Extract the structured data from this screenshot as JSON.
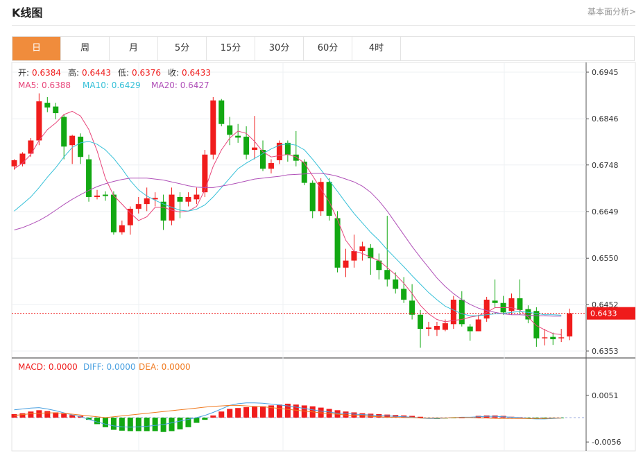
{
  "page": {
    "title": "K线图",
    "analysis_link": "基本面分析>"
  },
  "tabs": [
    "日",
    "周",
    "月",
    "5分",
    "15分",
    "30分",
    "60分",
    "4时"
  ],
  "active_tab": 0,
  "ohlc_legend": {
    "open_label": "开:",
    "open": "0.6384",
    "high_label": "高:",
    "high": "0.6443",
    "low_label": "低:",
    "low": "0.6376",
    "close_label": "收:",
    "close": "0.6433"
  },
  "ma_legend": {
    "ma5": "MA5: 0.6388",
    "ma10": "MA10: 0.6429",
    "ma20": "MA20: 0.6427"
  },
  "macd_legend": {
    "macd": "MACD: 0.0000",
    "diff": "DIFF: 0.0000",
    "dea": "DEA: 0.0000"
  },
  "colors": {
    "up": "#f01c1c",
    "down": "#12a812",
    "ma5": "#e8457a",
    "ma10": "#35c0d8",
    "ma20": "#b050b8",
    "diff": "#4aa0e0",
    "dea": "#f07a20",
    "current": "#ef1b1b",
    "accent_tab": "#f08c3c"
  },
  "chart_data": [
    {
      "type": "candlestick",
      "title": "",
      "ylim": [
        0.6325,
        0.6975
      ],
      "y_ticks": [
        "0.6945",
        "0.6846",
        "0.6748",
        "0.6649",
        "0.6550",
        "0.6452",
        "0.6353"
      ],
      "current_price": "0.6433",
      "candles": [
        [
          0.6745,
          0.6758,
          0.6738,
          0.676
        ],
        [
          0.675,
          0.6772,
          0.6745,
          0.6775
        ],
        [
          0.6772,
          0.68,
          0.6765,
          0.6805
        ],
        [
          0.68,
          0.6883,
          0.679,
          0.69
        ],
        [
          0.688,
          0.687,
          0.686,
          0.6892
        ],
        [
          0.6872,
          0.6858,
          0.6845,
          0.688
        ],
        [
          0.685,
          0.6787,
          0.676,
          0.6856
        ],
        [
          0.679,
          0.681,
          0.675,
          0.6812
        ],
        [
          0.6808,
          0.6765,
          0.675,
          0.6815
        ],
        [
          0.676,
          0.668,
          0.667,
          0.677
        ],
        [
          0.668,
          0.6683,
          0.6675,
          0.6695
        ],
        [
          0.6685,
          0.6682,
          0.6672,
          0.6692
        ],
        [
          0.6685,
          0.6605,
          0.66,
          0.6692
        ],
        [
          0.6605,
          0.662,
          0.66,
          0.663
        ],
        [
          0.662,
          0.6655,
          0.66,
          0.666
        ],
        [
          0.6655,
          0.6665,
          0.6645,
          0.668
        ],
        [
          0.6665,
          0.6677,
          0.665,
          0.67
        ],
        [
          0.6675,
          0.6678,
          0.666,
          0.669
        ],
        [
          0.667,
          0.663,
          0.661,
          0.6685
        ],
        [
          0.663,
          0.6685,
          0.662,
          0.67
        ],
        [
          0.668,
          0.667,
          0.6635,
          0.669
        ],
        [
          0.667,
          0.668,
          0.666,
          0.669
        ],
        [
          0.6675,
          0.6685,
          0.6665,
          0.67
        ],
        [
          0.669,
          0.677,
          0.668,
          0.678
        ],
        [
          0.677,
          0.6885,
          0.676,
          0.6892
        ],
        [
          0.6885,
          0.6835,
          0.683,
          0.6888
        ],
        [
          0.6832,
          0.6812,
          0.679,
          0.685
        ],
        [
          0.681,
          0.6806,
          0.6795,
          0.6835
        ],
        [
          0.6808,
          0.677,
          0.676,
          0.683
        ],
        [
          0.678,
          0.6785,
          0.676,
          0.6852
        ],
        [
          0.678,
          0.674,
          0.6735,
          0.68
        ],
        [
          0.674,
          0.6752,
          0.673,
          0.676
        ],
        [
          0.6758,
          0.6795,
          0.675,
          0.68
        ],
        [
          0.6795,
          0.677,
          0.6755,
          0.68
        ],
        [
          0.677,
          0.6757,
          0.6745,
          0.682
        ],
        [
          0.6755,
          0.671,
          0.6705,
          0.676
        ],
        [
          0.671,
          0.665,
          0.6635,
          0.6715
        ],
        [
          0.665,
          0.6712,
          0.664,
          0.672
        ],
        [
          0.6712,
          0.664,
          0.663,
          0.672
        ],
        [
          0.6635,
          0.653,
          0.652,
          0.665
        ],
        [
          0.653,
          0.6545,
          0.651,
          0.657
        ],
        [
          0.6545,
          0.6565,
          0.653,
          0.66
        ],
        [
          0.6565,
          0.6575,
          0.6545,
          0.6585
        ],
        [
          0.6572,
          0.655,
          0.6515,
          0.658
        ],
        [
          0.6545,
          0.6525,
          0.6505,
          0.656
        ],
        [
          0.6525,
          0.6505,
          0.649,
          0.664
        ],
        [
          0.6505,
          0.6485,
          0.6475,
          0.652
        ],
        [
          0.6485,
          0.6462,
          0.6455,
          0.651
        ],
        [
          0.646,
          0.643,
          0.642,
          0.6495
        ],
        [
          0.643,
          0.64,
          0.636,
          0.644
        ],
        [
          0.64,
          0.6403,
          0.6385,
          0.6415
        ],
        [
          0.6398,
          0.6406,
          0.6385,
          0.6415
        ],
        [
          0.6398,
          0.6412,
          0.6395,
          0.642
        ],
        [
          0.641,
          0.6462,
          0.64,
          0.647
        ],
        [
          0.6462,
          0.641,
          0.6405,
          0.648
        ],
        [
          0.6405,
          0.6395,
          0.6375,
          0.641
        ],
        [
          0.6395,
          0.642,
          0.6395,
          0.643
        ],
        [
          0.6422,
          0.6462,
          0.6415,
          0.6468
        ],
        [
          0.646,
          0.6455,
          0.6445,
          0.6505
        ],
        [
          0.6455,
          0.6435,
          0.643,
          0.647
        ],
        [
          0.6438,
          0.6465,
          0.643,
          0.6475
        ],
        [
          0.6465,
          0.644,
          0.643,
          0.6505
        ],
        [
          0.6442,
          0.642,
          0.6412,
          0.645
        ],
        [
          0.6438,
          0.638,
          0.6362,
          0.6446
        ],
        [
          0.638,
          0.6382,
          0.6365,
          0.64
        ],
        [
          0.6383,
          0.6378,
          0.6366,
          0.6392
        ],
        [
          0.638,
          0.6382,
          0.6372,
          0.64
        ],
        [
          0.6384,
          0.6433,
          0.6376,
          0.6443
        ]
      ],
      "ma5": [
        0.674,
        0.6752,
        0.677,
        0.68,
        0.6823,
        0.6837,
        0.6855,
        0.6862,
        0.6852,
        0.6823,
        0.6778,
        0.672,
        0.6683,
        0.6665,
        0.6646,
        0.663,
        0.6638,
        0.6658,
        0.6658,
        0.6652,
        0.6648,
        0.665,
        0.666,
        0.6695,
        0.6745,
        0.678,
        0.6805,
        0.682,
        0.6815,
        0.6798,
        0.6776,
        0.6765,
        0.6768,
        0.677,
        0.6765,
        0.6752,
        0.6725,
        0.6697,
        0.667,
        0.6632,
        0.6588,
        0.6565,
        0.656,
        0.6552,
        0.6545,
        0.653,
        0.6515,
        0.6497,
        0.6475,
        0.645,
        0.6432,
        0.642,
        0.6415,
        0.6418,
        0.642,
        0.6425,
        0.6428,
        0.6435,
        0.6445,
        0.6445,
        0.6445,
        0.644,
        0.6425,
        0.6407,
        0.6398,
        0.639,
        0.6388
      ],
      "ma10": [
        0.665,
        0.6665,
        0.668,
        0.67,
        0.6722,
        0.6742,
        0.6765,
        0.6785,
        0.6795,
        0.6798,
        0.6792,
        0.678,
        0.6762,
        0.674,
        0.6715,
        0.6695,
        0.6682,
        0.6673,
        0.6665,
        0.6658,
        0.6652,
        0.665,
        0.6654,
        0.6663,
        0.668,
        0.67,
        0.672,
        0.674,
        0.6752,
        0.6762,
        0.6772,
        0.6782,
        0.679,
        0.6793,
        0.679,
        0.678,
        0.676,
        0.6738,
        0.6715,
        0.6692,
        0.6668,
        0.6645,
        0.6625,
        0.6605,
        0.6588,
        0.6568,
        0.655,
        0.6532,
        0.6513,
        0.6495,
        0.6477,
        0.6462,
        0.6448,
        0.644,
        0.6432,
        0.6428,
        0.6428,
        0.643,
        0.6432,
        0.6433,
        0.6435,
        0.6437,
        0.6435,
        0.6433,
        0.643,
        0.643,
        0.6429
      ],
      "ma20": [
        0.661,
        0.6615,
        0.6622,
        0.663,
        0.664,
        0.6652,
        0.6664,
        0.6675,
        0.6685,
        0.6694,
        0.6702,
        0.6708,
        0.6713,
        0.6717,
        0.672,
        0.672,
        0.672,
        0.6718,
        0.6716,
        0.6712,
        0.6708,
        0.6704,
        0.6701,
        0.67,
        0.67,
        0.6703,
        0.6706,
        0.671,
        0.6714,
        0.6718,
        0.672,
        0.6722,
        0.6724,
        0.6727,
        0.6728,
        0.6729,
        0.673,
        0.673,
        0.6728,
        0.6724,
        0.6718,
        0.6712,
        0.6703,
        0.669,
        0.6672,
        0.665,
        0.6625,
        0.66,
        0.6575,
        0.6552,
        0.653,
        0.6508,
        0.649,
        0.6475,
        0.6462,
        0.6452,
        0.6444,
        0.6439,
        0.6435,
        0.6432,
        0.643,
        0.643,
        0.6429,
        0.6428,
        0.6428,
        0.6427,
        0.6427
      ]
    },
    {
      "type": "macd",
      "y_ticks": [
        "0.0051",
        "-0.0056"
      ],
      "ylim": [
        -0.0063,
        0.0078
      ],
      "histogram": [
        0.0008,
        0.001,
        0.0014,
        0.0017,
        0.0015,
        0.0012,
        0.0009,
        0.0006,
        0.0004,
        -0.0005,
        -0.0015,
        -0.0022,
        -0.0028,
        -0.003,
        -0.0031,
        -0.0031,
        -0.0031,
        -0.0031,
        -0.0033,
        -0.0031,
        -0.0027,
        -0.0022,
        -0.0012,
        -0.0005,
        0.0005,
        0.0014,
        0.002,
        0.0022,
        0.0024,
        0.0025,
        0.0026,
        0.0028,
        0.003,
        0.0032,
        0.003,
        0.0028,
        0.0026,
        0.0023,
        0.002,
        0.0017,
        0.0014,
        0.0012,
        0.001,
        0.0009,
        0.0008,
        0.0007,
        0.0006,
        0.0005,
        0.0004,
        0.0002,
        -0.0002,
        -0.0003,
        -0.0002,
        -0.0001,
        0.0,
        0.0001,
        0.0004,
        0.0005,
        0.0005,
        0.0004,
        0.0002,
        0.0001,
        -0.0002,
        -0.0003,
        -0.0003,
        -0.0002,
        -0.0001
      ],
      "diff": [
        0.0018,
        0.002,
        0.0022,
        0.0023,
        0.002,
        0.0016,
        0.0011,
        0.0006,
        0.0002,
        -0.0004,
        -0.001,
        -0.0015,
        -0.0019,
        -0.0021,
        -0.0022,
        -0.0021,
        -0.002,
        -0.0018,
        -0.0016,
        -0.0012,
        -0.0008,
        -0.0004,
        0.0,
        0.0005,
        0.0012,
        0.002,
        0.0028,
        0.0032,
        0.0034,
        0.0034,
        0.0033,
        0.0031,
        0.0029,
        0.0027,
        0.0024,
        0.0021,
        0.0018,
        0.0015,
        0.0013,
        0.001,
        0.001,
        0.0008,
        0.0007,
        0.0006,
        0.0005,
        0.0004,
        0.0003,
        0.0002,
        0.0001,
        -0.0001,
        -0.0002,
        -0.0002,
        -0.0001,
        0.0,
        0.0001,
        0.0001,
        0.0002,
        0.0003,
        0.0003,
        0.0002,
        0.0001,
        0.0,
        -0.0002,
        -0.0003,
        -0.0003,
        -0.0002,
        -0.0001
      ],
      "dea": [
        0.0005,
        0.0007,
        0.0009,
        0.001,
        0.0011,
        0.0011,
        0.001,
        0.0008,
        0.0006,
        0.0004,
        0.0002,
        0.0,
        0.0002,
        0.0004,
        0.0006,
        0.0008,
        0.001,
        0.0012,
        0.0014,
        0.0016,
        0.0018,
        0.002,
        0.0022,
        0.0024,
        0.0026,
        0.0027,
        0.0028,
        0.0028,
        0.0027,
        0.0026,
        0.0025,
        0.0023,
        0.0021,
        0.0019,
        0.0017,
        0.0015,
        0.0013,
        0.0011,
        0.0009,
        0.0008,
        0.0006,
        0.0005,
        0.0004,
        0.0003,
        0.0002,
        0.0001,
        0.0001,
        0.0,
        0.0,
        -0.0001,
        -0.0001,
        -0.0001,
        -0.0001,
        0.0,
        0.0,
        0.0,
        -0.0001,
        -0.0001,
        -0.0002,
        -0.0002,
        -0.0002,
        -0.0002,
        -0.0002,
        -0.0002,
        -0.0002,
        -0.0001,
        -0.0001
      ]
    }
  ]
}
